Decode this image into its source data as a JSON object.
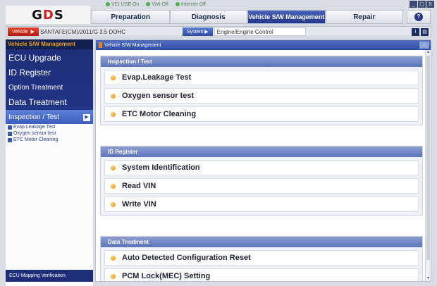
{
  "status": {
    "vci": "VCI",
    "usb": "USB On",
    "vmi": "VMI",
    "vmi_state": "Off",
    "internet": "Internet",
    "internet_state": "Off"
  },
  "window_buttons": [
    "_",
    "□",
    "X"
  ],
  "logo": {
    "text_a": "G",
    "text_b": "D",
    "text_c": "S"
  },
  "topnav": [
    {
      "label": "Preparation",
      "active": false
    },
    {
      "label": "Diagnosis",
      "active": false
    },
    {
      "label": "Vehicle S/W Management",
      "active": true
    },
    {
      "label": "Repair",
      "active": false
    }
  ],
  "vehicle_bar": {
    "vehicle_button": "Vehicle",
    "vehicle": "SANTAFE(CM)/2011/G 3.5 DOHC",
    "system_button": "System",
    "system": "Engine/Engine Control"
  },
  "sidebar": {
    "header": "Vehicle S/W Management",
    "items": [
      {
        "label": "ECU Upgrade"
      },
      {
        "label": "ID Register"
      },
      {
        "label": "Option Treatment"
      },
      {
        "label": "Data Treatment"
      },
      {
        "label": "Inspection / Test"
      }
    ],
    "sub_items": [
      {
        "label": "Evap.Leakage Test"
      },
      {
        "label": "Oxygen sensor test"
      },
      {
        "label": "ETC Motor Cleaning"
      }
    ],
    "footer": "ECU Mapping Verification"
  },
  "main": {
    "title": "Vehicle S/W Management",
    "sections": [
      {
        "title": "Inspection / Test",
        "items": [
          "Evap.Leakage Test",
          "Oxygen sensor test",
          "ETC Motor Cleaning"
        ]
      },
      {
        "title": "ID Register",
        "items": [
          "System Identification",
          "Read VIN",
          "Write VIN"
        ]
      },
      {
        "title": "Data Treatment",
        "items": [
          "Auto Detected Configuration Reset",
          "PCM Lock(MEC) Setting"
        ]
      }
    ]
  }
}
